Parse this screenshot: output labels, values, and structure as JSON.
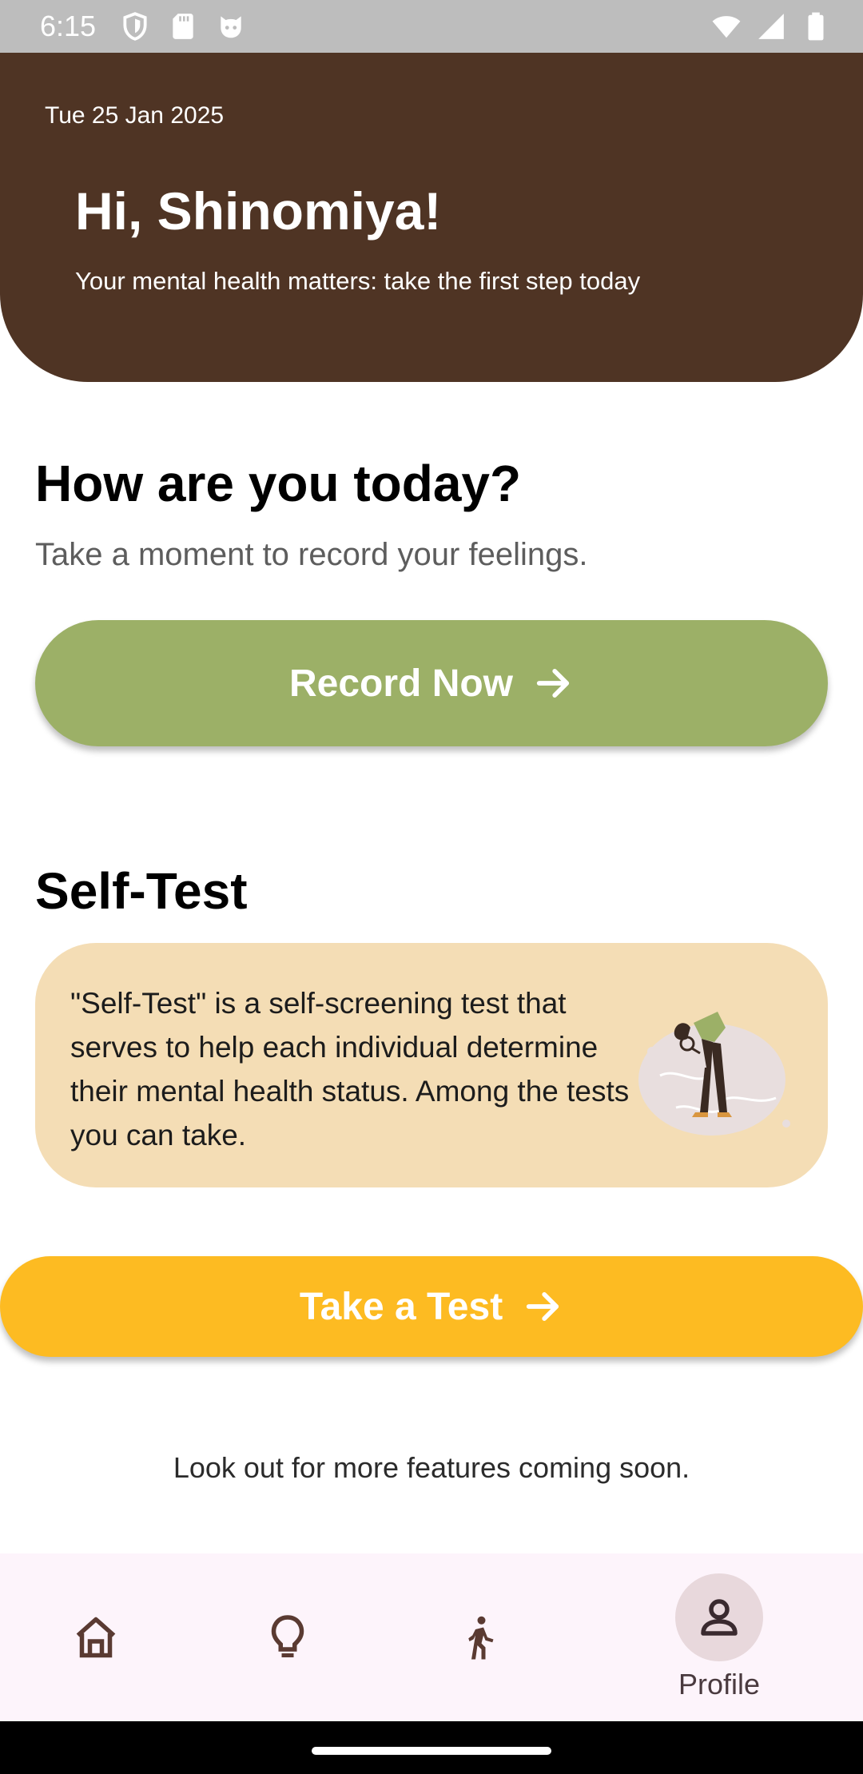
{
  "status_bar": {
    "time": "6:15",
    "left_icons": [
      "shield-icon",
      "sd-card-icon",
      "cat-face-icon"
    ],
    "right_icons": [
      "wifi-icon",
      "cellular-signal-icon",
      "battery-icon"
    ]
  },
  "header": {
    "date": "Tue 25 Jan 2025",
    "greeting": "Hi, Shinomiya!",
    "subtitle": "Your mental health matters: take the first step today",
    "background_color": "#4f3424"
  },
  "mood": {
    "title": "How are you today?",
    "subtitle": "Take a moment to record your feelings.",
    "button_label": "Record Now",
    "button_color": "#9cb067"
  },
  "self_test": {
    "title": "Self-Test",
    "description": "\"Self-Test\" is a self-screening test that serves to help each individual determine their mental health status. Among the tests you can take.",
    "card_color": "#f4ddb5",
    "button_label": "Take a Test",
    "button_color": "#fdbb22"
  },
  "footer_note": "Look out for more features coming soon.",
  "bottom_nav": {
    "items": [
      {
        "icon": "home-icon",
        "label": ""
      },
      {
        "icon": "lightbulb-icon",
        "label": ""
      },
      {
        "icon": "walking-person-icon",
        "label": ""
      },
      {
        "icon": "profile-icon",
        "label": "Profile",
        "selected": true
      }
    ]
  }
}
